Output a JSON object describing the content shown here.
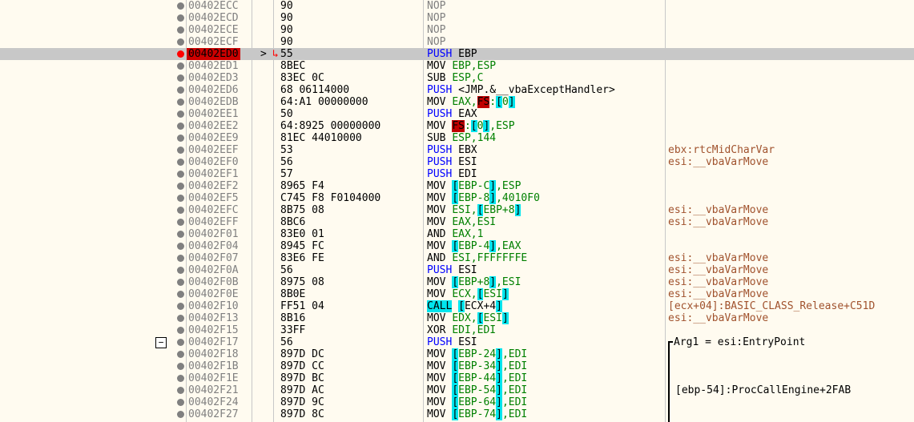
{
  "rows": [
    {
      "addr": "00402ECC",
      "bytes": "90",
      "op": "NOP",
      "oper": "",
      "cmt": "",
      "cls": "nop"
    },
    {
      "addr": "00402ECD",
      "bytes": "90",
      "op": "NOP",
      "oper": "",
      "cmt": "",
      "cls": "nop"
    },
    {
      "addr": "00402ECE",
      "bytes": "90",
      "op": "NOP",
      "oper": "",
      "cmt": "",
      "cls": "nop"
    },
    {
      "addr": "00402ECF",
      "bytes": "90",
      "op": "NOP",
      "oper": "",
      "cmt": "",
      "cls": "nop"
    },
    {
      "addr": "00402ED0",
      "bytes": "55",
      "op": "PUSH",
      "oper": "EBP",
      "cmt": "",
      "cls": "push",
      "current": true
    },
    {
      "addr": "00402ED1",
      "bytes": "8BEC",
      "op": "MOV",
      "oper": "EBP,ESP",
      "cmt": "",
      "cls": "mov"
    },
    {
      "addr": "00402ED3",
      "bytes": "83EC 0C",
      "op": "SUB",
      "oper": "ESP,C",
      "cmt": "",
      "cls": "mov"
    },
    {
      "addr": "00402ED6",
      "bytes": "68 06114000",
      "op": "PUSH",
      "oper": "<JMP.&__vbaExceptHandler>",
      "cmt": "",
      "cls": "push"
    },
    {
      "addr": "00402EDB",
      "bytes": "64:A1 00000000",
      "op": "MOV",
      "oper": "EAX,FS:[0]",
      "cmt": "",
      "cls": "mov"
    },
    {
      "addr": "00402EE1",
      "bytes": "50",
      "op": "PUSH",
      "oper": "EAX",
      "cmt": "",
      "cls": "push"
    },
    {
      "addr": "00402EE2",
      "bytes": "64:8925 00000000",
      "op": "MOV",
      "oper": "FS:[0],ESP",
      "cmt": "",
      "cls": "mov"
    },
    {
      "addr": "00402EE9",
      "bytes": "81EC 44010000",
      "op": "SUB",
      "oper": "ESP,144",
      "cmt": "",
      "cls": "mov"
    },
    {
      "addr": "00402EEF",
      "bytes": "53",
      "op": "PUSH",
      "oper": "EBX",
      "cmt": "ebx:rtcMidCharVar",
      "cls": "push"
    },
    {
      "addr": "00402EF0",
      "bytes": "56",
      "op": "PUSH",
      "oper": "ESI",
      "cmt": "esi:__vbaVarMove",
      "cls": "push"
    },
    {
      "addr": "00402EF1",
      "bytes": "57",
      "op": "PUSH",
      "oper": "EDI",
      "cmt": "",
      "cls": "push"
    },
    {
      "addr": "00402EF2",
      "bytes": "8965 F4",
      "op": "MOV",
      "oper": "[EBP-C],ESP",
      "cmt": "",
      "cls": "mov"
    },
    {
      "addr": "00402EF5",
      "bytes": "C745 F8 F0104000",
      "op": "MOV",
      "oper": "[EBP-8],4010F0",
      "cmt": "",
      "cls": "mov"
    },
    {
      "addr": "00402EFC",
      "bytes": "8B75 08",
      "op": "MOV",
      "oper": "ESI,[EBP+8]",
      "cmt": "esi:__vbaVarMove",
      "cls": "mov"
    },
    {
      "addr": "00402EFF",
      "bytes": "8BC6",
      "op": "MOV",
      "oper": "EAX,ESI",
      "cmt": "esi:__vbaVarMove",
      "cls": "mov"
    },
    {
      "addr": "00402F01",
      "bytes": "83E0 01",
      "op": "AND",
      "oper": "EAX,1",
      "cmt": "",
      "cls": "mov"
    },
    {
      "addr": "00402F04",
      "bytes": "8945 FC",
      "op": "MOV",
      "oper": "[EBP-4],EAX",
      "cmt": "",
      "cls": "mov"
    },
    {
      "addr": "00402F07",
      "bytes": "83E6 FE",
      "op": "AND",
      "oper": "ESI,FFFFFFFE",
      "cmt": "esi:__vbaVarMove",
      "cls": "mov"
    },
    {
      "addr": "00402F0A",
      "bytes": "56",
      "op": "PUSH",
      "oper": "ESI",
      "cmt": "esi:__vbaVarMove",
      "cls": "push"
    },
    {
      "addr": "00402F0B",
      "bytes": "8975 08",
      "op": "MOV",
      "oper": "[EBP+8],ESI",
      "cmt": "esi:__vbaVarMove",
      "cls": "mov"
    },
    {
      "addr": "00402F0E",
      "bytes": "8B0E",
      "op": "MOV",
      "oper": "ECX,[ESI]",
      "cmt": "esi:__vbaVarMove",
      "cls": "mov"
    },
    {
      "addr": "00402F10",
      "bytes": "FF51 04",
      "op": "CALL",
      "oper": "[ECX+4]",
      "cmt": "[ecx+04]:BASIC_CLASS_Release+C51D",
      "cls": "call"
    },
    {
      "addr": "00402F13",
      "bytes": "8B16",
      "op": "MOV",
      "oper": "EDX,[ESI]",
      "cmt": "esi:__vbaVarMove",
      "cls": "mov"
    },
    {
      "addr": "00402F15",
      "bytes": "33FF",
      "op": "XOR",
      "oper": "EDI,EDI",
      "cmt": "",
      "cls": "mov"
    },
    {
      "addr": "00402F17",
      "bytes": "56",
      "op": "PUSH",
      "oper": "ESI",
      "cmt": "Arg1 = esi:EntryPoint",
      "cls": "push"
    },
    {
      "addr": "00402F18",
      "bytes": "897D DC",
      "op": "MOV",
      "oper": "[EBP-24],EDI",
      "cmt": "",
      "cls": "mov"
    },
    {
      "addr": "00402F1B",
      "bytes": "897D CC",
      "op": "MOV",
      "oper": "[EBP-34],EDI",
      "cmt": "",
      "cls": "mov"
    },
    {
      "addr": "00402F1E",
      "bytes": "897D BC",
      "op": "MOV",
      "oper": "[EBP-44],EDI",
      "cmt": "",
      "cls": "mov"
    },
    {
      "addr": "00402F21",
      "bytes": "897D AC",
      "op": "MOV",
      "oper": "[EBP-54],EDI",
      "cmt": "[ebp-54]:ProcCallEngine+2FAB",
      "cls": "mov"
    },
    {
      "addr": "00402F24",
      "bytes": "897D 9C",
      "op": "MOV",
      "oper": "[EBP-64],EDI",
      "cmt": "",
      "cls": "mov"
    },
    {
      "addr": "00402F27",
      "bytes": "897D 8C",
      "op": "MOV",
      "oper": "[EBP-74],EDI",
      "cmt": "",
      "cls": "mov"
    }
  ],
  "cursor_marker": ">",
  "jump_arrow": "↳",
  "fold_glyph": "−"
}
